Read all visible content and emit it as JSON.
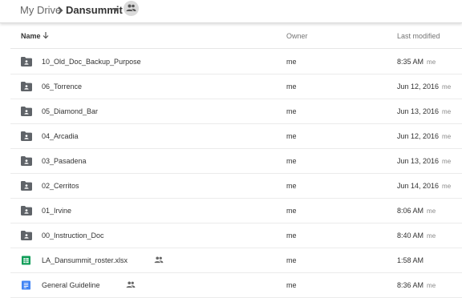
{
  "breadcrumb": {
    "root": "My Drive",
    "current": "Dansummit"
  },
  "columns": {
    "name": "Name",
    "owner": "Owner",
    "modified": "Last modified"
  },
  "colors": {
    "folder": "#5f6368",
    "sheets": "#0f9d58",
    "docs": "#4285f4"
  },
  "files": [
    {
      "name": "10_Old_Doc_Backup_Purpose",
      "type": "folder",
      "icon": "shared-folder-icon",
      "owner": "me",
      "modified": "8:35 AM",
      "modified_by": "me",
      "shared": false
    },
    {
      "name": "06_Torrence",
      "type": "folder",
      "icon": "shared-folder-icon",
      "owner": "me",
      "modified": "Jun 12, 2016",
      "modified_by": "me",
      "shared": false
    },
    {
      "name": "05_Diamond_Bar",
      "type": "folder",
      "icon": "shared-folder-icon",
      "owner": "me",
      "modified": "Jun 13, 2016",
      "modified_by": "me",
      "shared": false
    },
    {
      "name": "04_Arcadia",
      "type": "folder",
      "icon": "shared-folder-icon",
      "owner": "me",
      "modified": "Jun 12, 2016",
      "modified_by": "me",
      "shared": false
    },
    {
      "name": "03_Pasadena",
      "type": "folder",
      "icon": "shared-folder-icon",
      "owner": "me",
      "modified": "Jun 13, 2016",
      "modified_by": "me",
      "shared": false
    },
    {
      "name": "02_Cerritos",
      "type": "folder",
      "icon": "shared-folder-icon",
      "owner": "me",
      "modified": "Jun 14, 2016",
      "modified_by": "me",
      "shared": false
    },
    {
      "name": "01_Irvine",
      "type": "folder",
      "icon": "shared-folder-icon",
      "owner": "me",
      "modified": "8:06 AM",
      "modified_by": "me",
      "shared": false
    },
    {
      "name": "00_Instruction_Doc",
      "type": "folder",
      "icon": "shared-folder-icon",
      "owner": "me",
      "modified": "8:40 AM",
      "modified_by": "me",
      "shared": false
    },
    {
      "name": "LA_Dansummit_roster.xlsx",
      "type": "sheet",
      "icon": "spreadsheet-icon",
      "owner": "me",
      "modified": "1:58 AM",
      "modified_by": "",
      "shared": true
    },
    {
      "name": "General Guideline",
      "type": "doc",
      "icon": "document-icon",
      "owner": "me",
      "modified": "8:36 AM",
      "modified_by": "me",
      "shared": true
    }
  ]
}
